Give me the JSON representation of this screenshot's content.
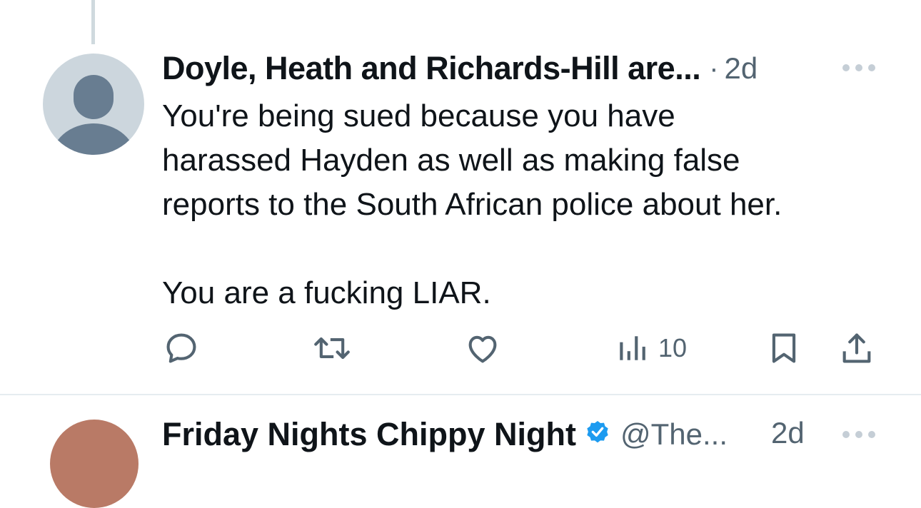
{
  "tweet": {
    "author_name": "Doyle, Heath and Richards-Hill are...",
    "separator": "·",
    "time": "2d",
    "avatar_icon": "default-avatar-icon",
    "more_icon": "more-options-icon",
    "text_lines": [
      "You're being sued because you have",
      "harassed Hayden as well as making false",
      "reports to the South African police about her."
    ],
    "text_second_paragraph": "You are a fucking LIAR.",
    "actions": {
      "reply_icon": "reply-icon",
      "retweet_icon": "retweet-icon",
      "like_icon": "like-icon",
      "views_icon": "views-icon",
      "views_count": "10",
      "bookmark_icon": "bookmark-icon",
      "share_icon": "share-icon"
    }
  },
  "next_tweet": {
    "author_name": "Friday Nights Chippy Night",
    "verified_icon": "verified-badge-icon",
    "handle": "@The...",
    "time": "2d",
    "more_icon": "more-options-icon"
  },
  "colors": {
    "text_primary": "#0f1419",
    "text_secondary": "#536471",
    "thread_line": "#cfd9de",
    "avatar_bg": "#ccd6dd",
    "avatar_fg": "#687d91",
    "verified": "#1d9bf0",
    "divider": "#e6ecf0"
  }
}
